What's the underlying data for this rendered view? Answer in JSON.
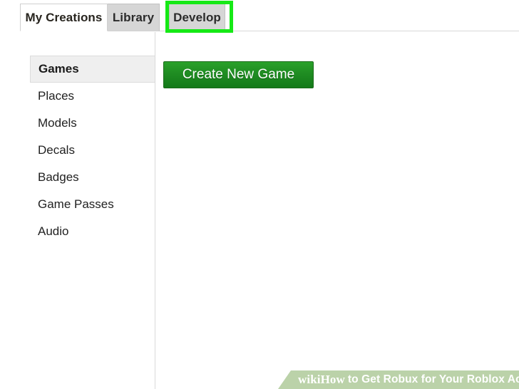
{
  "tabs": [
    {
      "label": "My Creations",
      "state": "active"
    },
    {
      "label": "Library",
      "state": "inactive"
    },
    {
      "label": "Develop",
      "state": "inactive",
      "highlighted": true
    }
  ],
  "sidebar": {
    "items": [
      {
        "label": "Games",
        "selected": true
      },
      {
        "label": "Places",
        "selected": false
      },
      {
        "label": "Models",
        "selected": false
      },
      {
        "label": "Decals",
        "selected": false
      },
      {
        "label": "Badges",
        "selected": false
      },
      {
        "label": "Game Passes",
        "selected": false
      },
      {
        "label": "Audio",
        "selected": false
      }
    ]
  },
  "main": {
    "create_button_label": "Create New Game"
  },
  "watermark": {
    "wiki": "wiki",
    "how": "How",
    "text": "to Get Robux for Your Roblox Account"
  },
  "colors": {
    "highlight_green": "#16e916",
    "button_green": "#1f8c22",
    "tab_inactive_gray": "#d6d6d6",
    "sidebar_selected_gray": "#efefef",
    "watermark_green": "#92b774"
  }
}
